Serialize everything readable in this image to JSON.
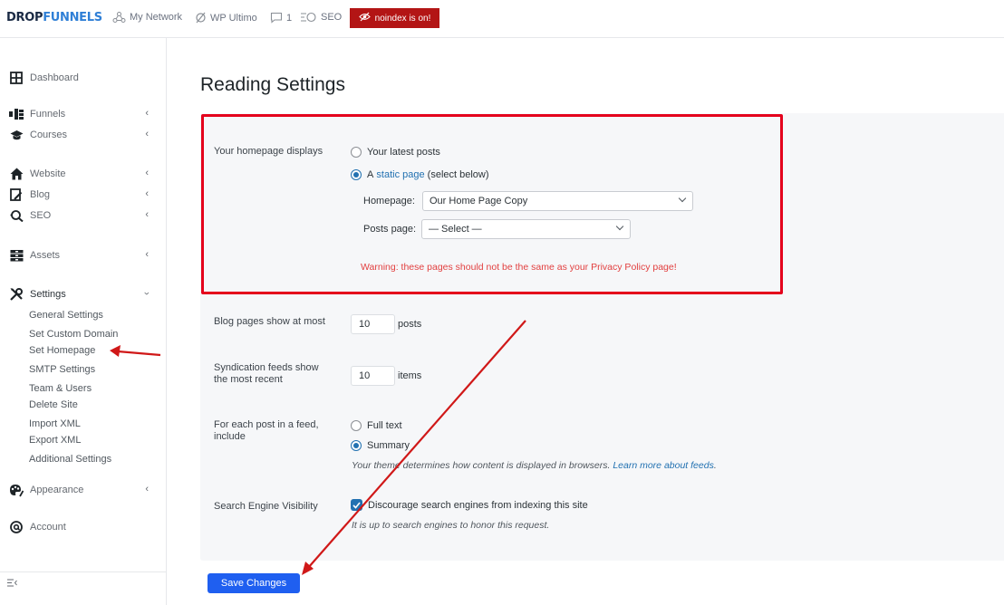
{
  "topbar": {
    "logo_part1": "DROP",
    "logo_part2": "FUNNELS",
    "my_network": "My Network",
    "wp_ultimo": "WP Ultimo",
    "comments_count": "1",
    "seo": "SEO",
    "noindex": "noindex is on!",
    "noindex_color": "#b31515"
  },
  "sidebar": {
    "dashboard": "Dashboard",
    "funnels": "Funnels",
    "courses": "Courses",
    "website": "Website",
    "blog": "Blog",
    "seo": "SEO",
    "assets": "Assets",
    "settings": "Settings",
    "settings_sub": [
      "General Settings",
      "Set Custom Domain",
      "Set Homepage",
      "SMTP Settings",
      "Team & Users",
      "Delete Site",
      "Import XML",
      "Export XML",
      "Additional Settings"
    ],
    "appearance": "Appearance",
    "account": "Account"
  },
  "page": {
    "title": "Reading Settings",
    "homepage_displays_label": "Your homepage displays",
    "latest_posts": "Your latest posts",
    "static_a": "A",
    "static_link": "static page",
    "static_suffix": "(select below)",
    "homepage_label": "Homepage:",
    "homepage_value": "Our Home Page Copy",
    "posts_page_label": "Posts page:",
    "posts_page_value": "— Select —",
    "warning": "Warning: these pages should not be the same as your Privacy Policy page!",
    "blog_pages_label": "Blog pages show at most",
    "blog_pages_value": "10",
    "blog_pages_unit": "posts",
    "syndication_label_1": "Syndication feeds show",
    "syndication_label_2": "the most recent",
    "syndication_value": "10",
    "syndication_unit": "items",
    "feed_label_1": "For each post in a feed,",
    "feed_label_2": "include",
    "full_text": "Full text",
    "summary": "Summary",
    "feed_desc": "Your theme determines how content is displayed in browsers.",
    "feed_link": "Learn more about feeds",
    "search_vis_label": "Search Engine Visibility",
    "discourage": "Discourage search engines from indexing this site",
    "discourage_desc": "It is up to search engines to honor this request.",
    "save": "Save Changes"
  },
  "colors": {
    "accent": "#2271b1",
    "button": "#1f5ff0",
    "annotation": "#e4001c",
    "warning": "#e24040"
  }
}
